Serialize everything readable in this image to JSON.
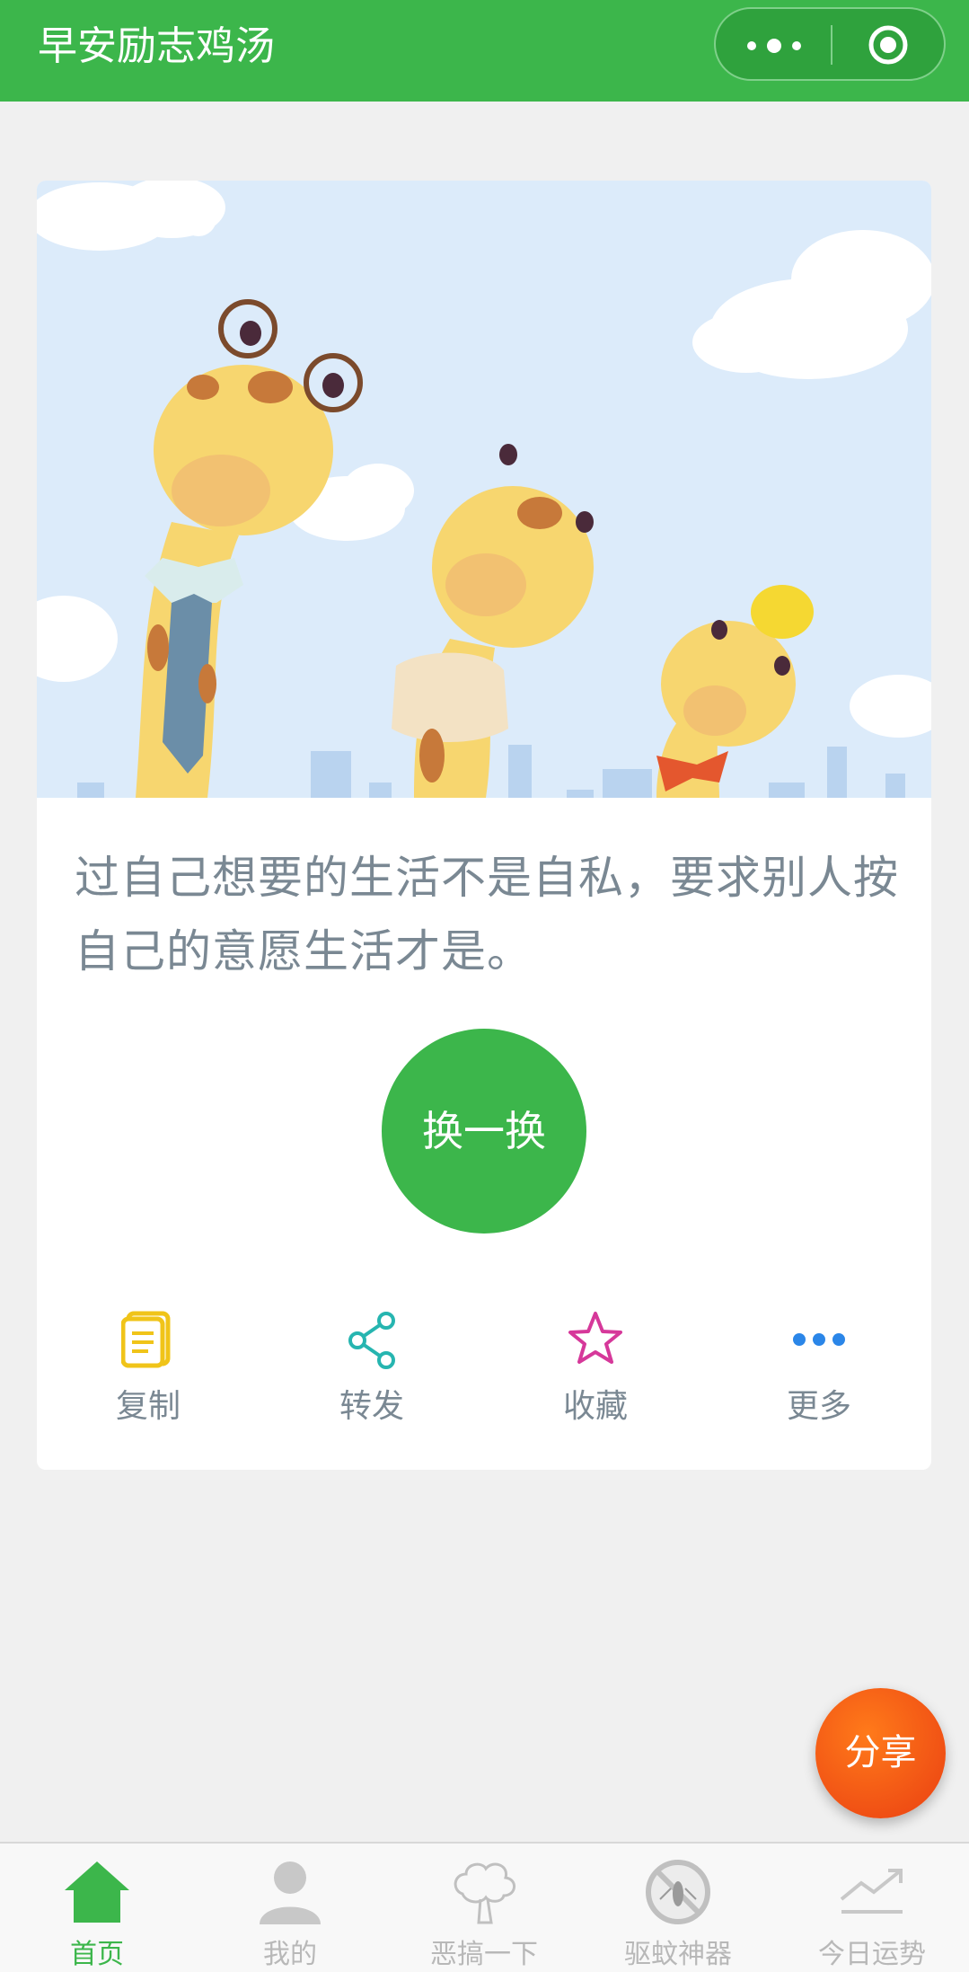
{
  "nav": {
    "title": "早安励志鸡汤",
    "more_icon": "more-dots-icon",
    "close_icon": "target-icon"
  },
  "banner": {
    "image": "giraffes-illustration"
  },
  "quote": {
    "text": "过自己想要的生活不是自私，要求别人按自己的意愿生活才是。"
  },
  "swap_button": {
    "label": "换一换"
  },
  "actions": [
    {
      "label": "复制",
      "icon": "copy-icon",
      "color": "#f0c419"
    },
    {
      "label": "转发",
      "icon": "share-icon",
      "color": "#26b5b0"
    },
    {
      "label": "收藏",
      "icon": "star-icon",
      "color": "#d6389a"
    },
    {
      "label": "更多",
      "icon": "more-icon",
      "color": "#2b86e8"
    }
  ],
  "share_fab": {
    "label": "分享"
  },
  "tabs": [
    {
      "label": "首页",
      "icon": "home-icon",
      "active": true
    },
    {
      "label": "我的",
      "icon": "user-icon",
      "active": false
    },
    {
      "label": "恶搞一下",
      "icon": "tree-icon",
      "active": false
    },
    {
      "label": "驱蚊神器",
      "icon": "mosquito-icon",
      "active": false
    },
    {
      "label": "今日运势",
      "icon": "trend-icon",
      "active": false
    }
  ],
  "colors": {
    "brand": "#3cb64b",
    "fab": "#ee4d15",
    "text": "#7a8893"
  }
}
